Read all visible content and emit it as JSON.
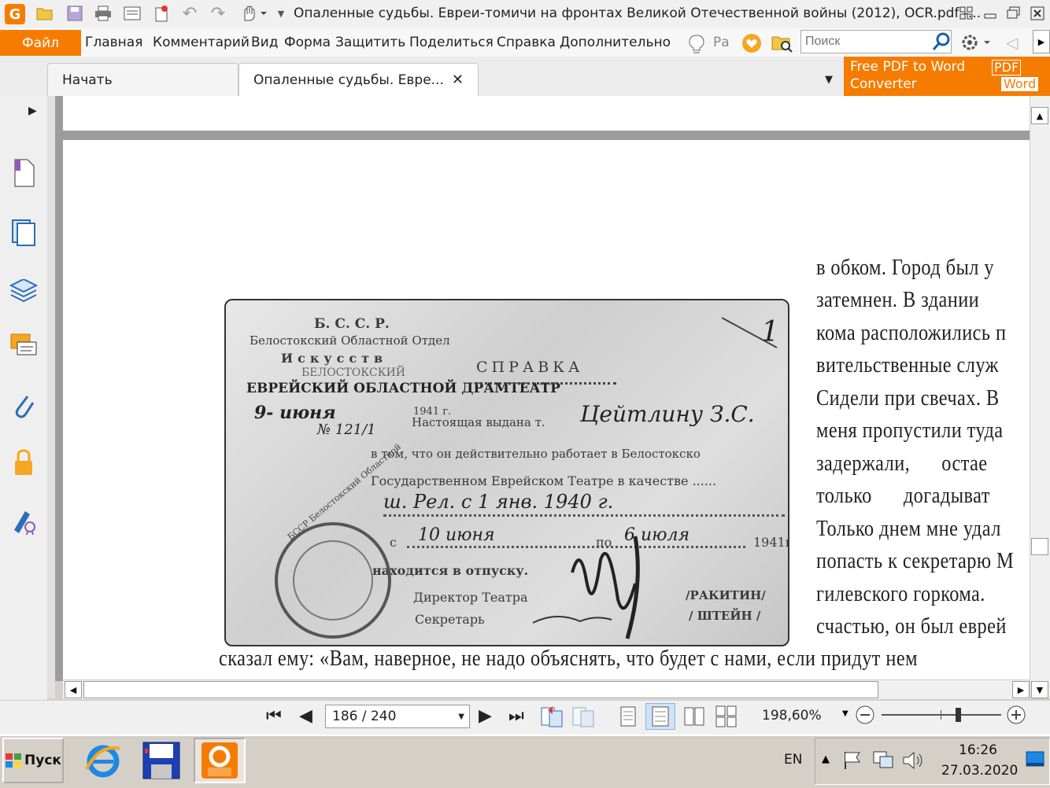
{
  "titlebar": {
    "title": "Опаленные судьбы. Евреи-томичи на фронтах Великой Отечественной войны (2012), OCR.pdf -..."
  },
  "menu": {
    "file": "Файл",
    "items": [
      "Главная",
      "Комментарий",
      "Вид",
      "Форма",
      "Защитить",
      "Поделиться",
      "Справка",
      "Дополнительно"
    ],
    "tell_me": "Ра",
    "search_placeholder": "Поиск"
  },
  "tabs": {
    "start": "Начать",
    "document": "Опаленные судьбы. Евре..."
  },
  "promo": {
    "line1": "Free PDF to Word",
    "line2": "Converter",
    "badge_pdf": "PDF",
    "badge_word": "Word"
  },
  "photo": {
    "corner_number": "1",
    "header1": "Б. С. С. Р.",
    "header2": "Белостокский Областной Отдел",
    "header3": "Искусств",
    "header4": "БЕЛОСТОКСКИЙ",
    "header5": "ЕВРЕЙСКИЙ ОБЛАСТНОЙ ДРАМТЕАТР",
    "date_hw": "9- июня",
    "year": "1941 г.",
    "number": "№ 121/1",
    "heading": "СПРАВКА",
    "line1": "Настоящая выдана т.",
    "line1_hw": "Цейтлину З.С.",
    "line2": "в том, что он действительно работает в Белостокско",
    "line3": "Государственном Еврейском Театре в качестве ......",
    "line4_hw": "ш. Рел. с 1 янв. 1940 г.",
    "line5": "с",
    "line5_hw1": "10 июня",
    "line5_mid": "по",
    "line5_hw2": "6 июля",
    "line5_year": "1941г",
    "line6": "находится в отпуску.",
    "director": "Директор Театра",
    "secretary": "Секретарь",
    "names1": "/РАКИТИН/",
    "names2": "/ ШТЕЙН /",
    "stamp_text": "БССР Белостокский Областной"
  },
  "book_text": [
    "в обком. Город был у",
    "затемнен. В здании",
    "кома расположились п",
    "вительственные служ",
    "Сидели при свечах. В",
    "меня пропустили туда",
    "задержали, остае",
    "только догадыват",
    "Только днем мне удал",
    "попасть к секретарю М",
    "гилевского горкома.",
    "счастью, он был еврей"
  ],
  "book_bottom_line": "сказал ему: «Вам, наверное, не надо объяснять, что будет с нами, если придут нем",
  "status": {
    "page": "186 / 240",
    "zoom": "198,60%"
  },
  "taskbar": {
    "start": "Пуск",
    "lang": "EN",
    "time": "16:26",
    "date": "27.03.2020"
  },
  "colors": {
    "accent": "#f57c00"
  }
}
